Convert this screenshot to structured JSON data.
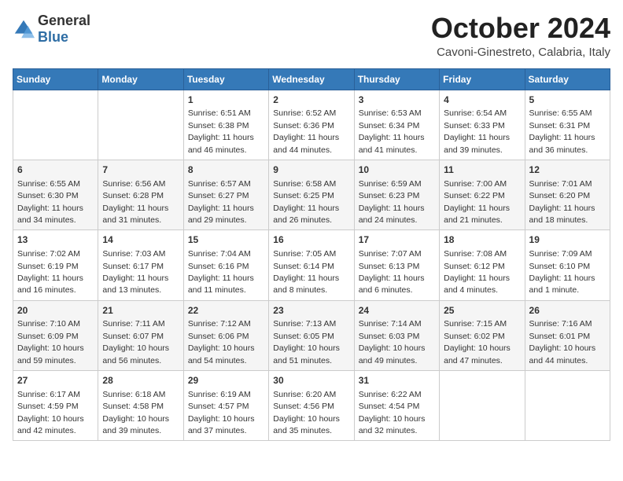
{
  "header": {
    "logo_general": "General",
    "logo_blue": "Blue",
    "month": "October 2024",
    "location": "Cavoni-Ginestreto, Calabria, Italy"
  },
  "weekdays": [
    "Sunday",
    "Monday",
    "Tuesday",
    "Wednesday",
    "Thursday",
    "Friday",
    "Saturday"
  ],
  "weeks": [
    [
      {
        "day": "",
        "sunrise": "",
        "sunset": "",
        "daylight": ""
      },
      {
        "day": "",
        "sunrise": "",
        "sunset": "",
        "daylight": ""
      },
      {
        "day": "1",
        "sunrise": "Sunrise: 6:51 AM",
        "sunset": "Sunset: 6:38 PM",
        "daylight": "Daylight: 11 hours and 46 minutes."
      },
      {
        "day": "2",
        "sunrise": "Sunrise: 6:52 AM",
        "sunset": "Sunset: 6:36 PM",
        "daylight": "Daylight: 11 hours and 44 minutes."
      },
      {
        "day": "3",
        "sunrise": "Sunrise: 6:53 AM",
        "sunset": "Sunset: 6:34 PM",
        "daylight": "Daylight: 11 hours and 41 minutes."
      },
      {
        "day": "4",
        "sunrise": "Sunrise: 6:54 AM",
        "sunset": "Sunset: 6:33 PM",
        "daylight": "Daylight: 11 hours and 39 minutes."
      },
      {
        "day": "5",
        "sunrise": "Sunrise: 6:55 AM",
        "sunset": "Sunset: 6:31 PM",
        "daylight": "Daylight: 11 hours and 36 minutes."
      }
    ],
    [
      {
        "day": "6",
        "sunrise": "Sunrise: 6:55 AM",
        "sunset": "Sunset: 6:30 PM",
        "daylight": "Daylight: 11 hours and 34 minutes."
      },
      {
        "day": "7",
        "sunrise": "Sunrise: 6:56 AM",
        "sunset": "Sunset: 6:28 PM",
        "daylight": "Daylight: 11 hours and 31 minutes."
      },
      {
        "day": "8",
        "sunrise": "Sunrise: 6:57 AM",
        "sunset": "Sunset: 6:27 PM",
        "daylight": "Daylight: 11 hours and 29 minutes."
      },
      {
        "day": "9",
        "sunrise": "Sunrise: 6:58 AM",
        "sunset": "Sunset: 6:25 PM",
        "daylight": "Daylight: 11 hours and 26 minutes."
      },
      {
        "day": "10",
        "sunrise": "Sunrise: 6:59 AM",
        "sunset": "Sunset: 6:23 PM",
        "daylight": "Daylight: 11 hours and 24 minutes."
      },
      {
        "day": "11",
        "sunrise": "Sunrise: 7:00 AM",
        "sunset": "Sunset: 6:22 PM",
        "daylight": "Daylight: 11 hours and 21 minutes."
      },
      {
        "day": "12",
        "sunrise": "Sunrise: 7:01 AM",
        "sunset": "Sunset: 6:20 PM",
        "daylight": "Daylight: 11 hours and 18 minutes."
      }
    ],
    [
      {
        "day": "13",
        "sunrise": "Sunrise: 7:02 AM",
        "sunset": "Sunset: 6:19 PM",
        "daylight": "Daylight: 11 hours and 16 minutes."
      },
      {
        "day": "14",
        "sunrise": "Sunrise: 7:03 AM",
        "sunset": "Sunset: 6:17 PM",
        "daylight": "Daylight: 11 hours and 13 minutes."
      },
      {
        "day": "15",
        "sunrise": "Sunrise: 7:04 AM",
        "sunset": "Sunset: 6:16 PM",
        "daylight": "Daylight: 11 hours and 11 minutes."
      },
      {
        "day": "16",
        "sunrise": "Sunrise: 7:05 AM",
        "sunset": "Sunset: 6:14 PM",
        "daylight": "Daylight: 11 hours and 8 minutes."
      },
      {
        "day": "17",
        "sunrise": "Sunrise: 7:07 AM",
        "sunset": "Sunset: 6:13 PM",
        "daylight": "Daylight: 11 hours and 6 minutes."
      },
      {
        "day": "18",
        "sunrise": "Sunrise: 7:08 AM",
        "sunset": "Sunset: 6:12 PM",
        "daylight": "Daylight: 11 hours and 4 minutes."
      },
      {
        "day": "19",
        "sunrise": "Sunrise: 7:09 AM",
        "sunset": "Sunset: 6:10 PM",
        "daylight": "Daylight: 11 hours and 1 minute."
      }
    ],
    [
      {
        "day": "20",
        "sunrise": "Sunrise: 7:10 AM",
        "sunset": "Sunset: 6:09 PM",
        "daylight": "Daylight: 10 hours and 59 minutes."
      },
      {
        "day": "21",
        "sunrise": "Sunrise: 7:11 AM",
        "sunset": "Sunset: 6:07 PM",
        "daylight": "Daylight: 10 hours and 56 minutes."
      },
      {
        "day": "22",
        "sunrise": "Sunrise: 7:12 AM",
        "sunset": "Sunset: 6:06 PM",
        "daylight": "Daylight: 10 hours and 54 minutes."
      },
      {
        "day": "23",
        "sunrise": "Sunrise: 7:13 AM",
        "sunset": "Sunset: 6:05 PM",
        "daylight": "Daylight: 10 hours and 51 minutes."
      },
      {
        "day": "24",
        "sunrise": "Sunrise: 7:14 AM",
        "sunset": "Sunset: 6:03 PM",
        "daylight": "Daylight: 10 hours and 49 minutes."
      },
      {
        "day": "25",
        "sunrise": "Sunrise: 7:15 AM",
        "sunset": "Sunset: 6:02 PM",
        "daylight": "Daylight: 10 hours and 47 minutes."
      },
      {
        "day": "26",
        "sunrise": "Sunrise: 7:16 AM",
        "sunset": "Sunset: 6:01 PM",
        "daylight": "Daylight: 10 hours and 44 minutes."
      }
    ],
    [
      {
        "day": "27",
        "sunrise": "Sunrise: 6:17 AM",
        "sunset": "Sunset: 4:59 PM",
        "daylight": "Daylight: 10 hours and 42 minutes."
      },
      {
        "day": "28",
        "sunrise": "Sunrise: 6:18 AM",
        "sunset": "Sunset: 4:58 PM",
        "daylight": "Daylight: 10 hours and 39 minutes."
      },
      {
        "day": "29",
        "sunrise": "Sunrise: 6:19 AM",
        "sunset": "Sunset: 4:57 PM",
        "daylight": "Daylight: 10 hours and 37 minutes."
      },
      {
        "day": "30",
        "sunrise": "Sunrise: 6:20 AM",
        "sunset": "Sunset: 4:56 PM",
        "daylight": "Daylight: 10 hours and 35 minutes."
      },
      {
        "day": "31",
        "sunrise": "Sunrise: 6:22 AM",
        "sunset": "Sunset: 4:54 PM",
        "daylight": "Daylight: 10 hours and 32 minutes."
      },
      {
        "day": "",
        "sunrise": "",
        "sunset": "",
        "daylight": ""
      },
      {
        "day": "",
        "sunrise": "",
        "sunset": "",
        "daylight": ""
      }
    ]
  ]
}
